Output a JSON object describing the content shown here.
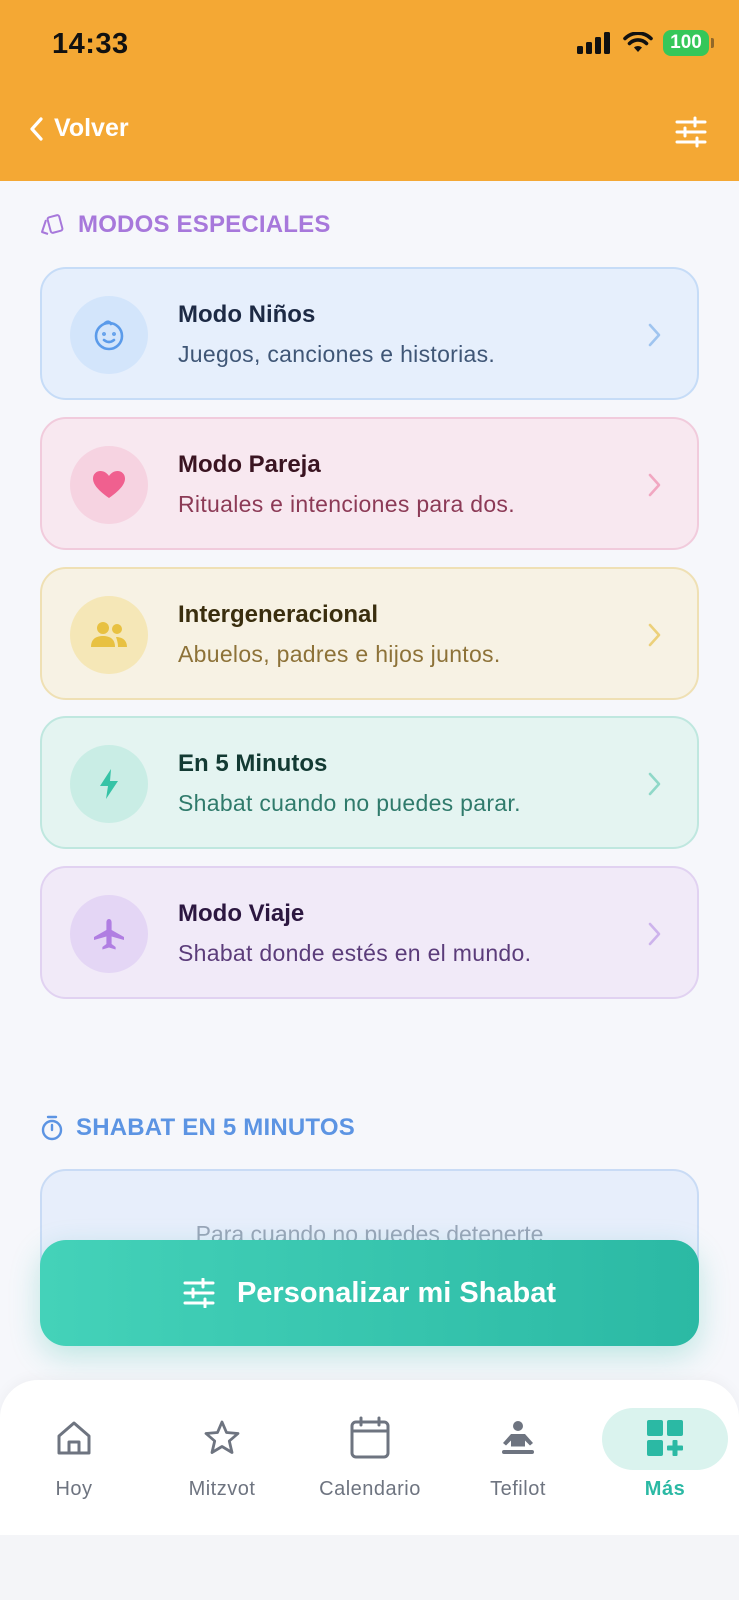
{
  "status_bar": {
    "time": "14:33",
    "battery": "100"
  },
  "header": {
    "back_label": "Volver"
  },
  "section_special": {
    "title": "MODOS ESPECIALES"
  },
  "modes": [
    {
      "title": "Modo Niños",
      "subtitle": "Juegos, canciones e historias.",
      "icon": "baby-face-icon",
      "accent": "#5b9bea"
    },
    {
      "title": "Modo Pareja",
      "subtitle": "Rituales e intenciones para dos.",
      "icon": "heart-icon",
      "accent": "#f0608f"
    },
    {
      "title": "Intergeneracional",
      "subtitle": "Abuelos, padres e hijos juntos.",
      "icon": "people-icon",
      "accent": "#e8c141"
    },
    {
      "title": "En 5 Minutos",
      "subtitle": "Shabat cuando no puedes parar.",
      "icon": "lightning-icon",
      "accent": "#36c3a6"
    },
    {
      "title": "Modo Viaje",
      "subtitle": "Shabat donde estés en el mundo.",
      "icon": "airplane-icon",
      "accent": "#b07ee2"
    }
  ],
  "section_five": {
    "title": "SHABAT EN 5 MINUTOS",
    "card_text": "Para cuando no puedes detenerte"
  },
  "cta": {
    "label": "Personalizar mi Shabat"
  },
  "tabs": [
    {
      "label": "Hoy",
      "icon": "home-icon"
    },
    {
      "label": "Mitzvot",
      "icon": "star-icon"
    },
    {
      "label": "Calendario",
      "icon": "calendar-icon"
    },
    {
      "label": "Tefilot",
      "icon": "prayer-person-icon"
    },
    {
      "label": "Más",
      "icon": "grid-plus-icon",
      "active": true
    }
  ],
  "colors": {
    "header": "#f4a834",
    "primary": "#2bb9a4",
    "special_heading": "#a778db",
    "five_heading": "#5c94e3"
  }
}
